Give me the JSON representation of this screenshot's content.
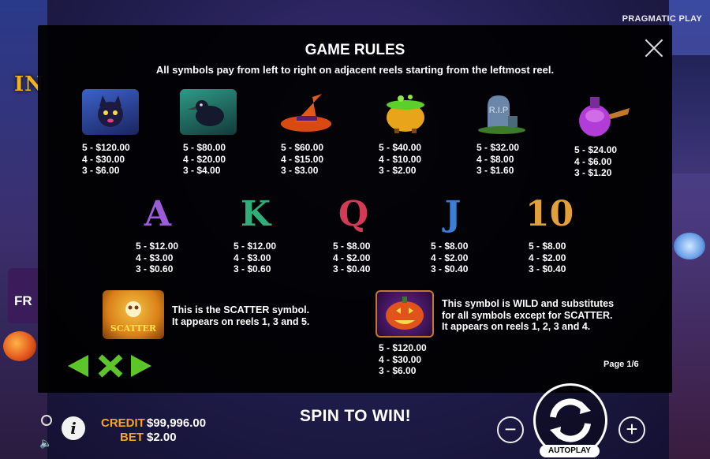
{
  "brand": "PRAGMATIC PLAY",
  "background": {
    "title_partial": "IN",
    "sign_partial": "FR"
  },
  "modal": {
    "title": "GAME RULES",
    "subtitle": "All symbols pay from left to right on adjacent reels starting from the leftmost reel.",
    "high_symbols": [
      {
        "icon": "black-cat-icon",
        "pays": [
          "5 - $120.00",
          "4 - $30.00",
          "3 - $6.00"
        ]
      },
      {
        "icon": "raven-icon",
        "pays": [
          "5 - $80.00",
          "4 - $20.00",
          "3 - $4.00"
        ]
      },
      {
        "icon": "witch-hat-icon",
        "pays": [
          "5 - $60.00",
          "4 - $15.00",
          "3 - $3.00"
        ]
      },
      {
        "icon": "cauldron-icon",
        "pays": [
          "5 - $40.00",
          "4 - $10.00",
          "3 - $2.00"
        ]
      },
      {
        "icon": "tombstone-icon",
        "pays": [
          "5 - $32.00",
          "4 - $8.00",
          "3 - $1.60"
        ]
      },
      {
        "icon": "potion-icon",
        "pays": [
          "5 - $24.00",
          "4 - $6.00",
          "3 - $1.20"
        ]
      }
    ],
    "low_symbols": [
      {
        "letter": "A",
        "color": "#9b5cd6",
        "pays": [
          "5 - $12.00",
          "4 - $3.00",
          "3 - $0.60"
        ]
      },
      {
        "letter": "K",
        "color": "#2fae7a",
        "pays": [
          "5 - $12.00",
          "4 - $3.00",
          "3 - $0.60"
        ]
      },
      {
        "letter": "Q",
        "color": "#d23a55",
        "pays": [
          "5 - $8.00",
          "4 - $2.00",
          "3 - $0.40"
        ]
      },
      {
        "letter": "J",
        "color": "#3a7fd4",
        "pays": [
          "5 - $8.00",
          "4 - $2.00",
          "3 - $0.40"
        ]
      },
      {
        "letter": "10",
        "color": "#e3a03a",
        "pays": [
          "5 - $8.00",
          "4 - $2.00",
          "3 - $0.40"
        ]
      }
    ],
    "scatter": {
      "icon_label": "SCATTER",
      "line1": "This is the SCATTER symbol.",
      "line2": "It appears on reels 1, 3 and 5."
    },
    "wild": {
      "line1": "This symbol is WILD and substitutes",
      "line2": "for all symbols except for SCATTER.",
      "line3": "It appears on reels 1, 2, 3 and 4.",
      "pays": [
        "5 - $120.00",
        "4 - $30.00",
        "3 - $6.00"
      ]
    },
    "page": "Page 1/6"
  },
  "bottom_bar": {
    "credit_label": "CREDIT",
    "credit_value": "$99,996.00",
    "bet_label": "BET",
    "bet_value": "$2.00",
    "message": "SPIN TO WIN!",
    "minus": "−",
    "plus": "+",
    "autoplay": "AUTOPLAY"
  }
}
